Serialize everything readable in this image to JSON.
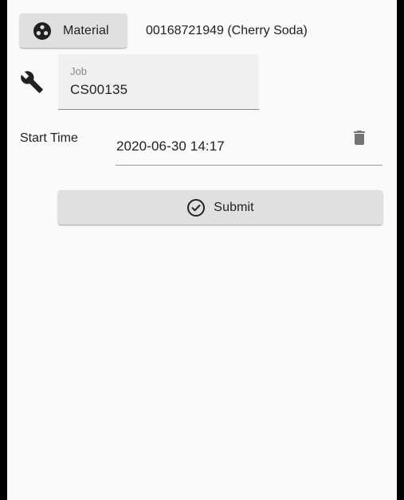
{
  "material": {
    "button_label": "Material",
    "button_icon": "material-icon",
    "value": "00168721949 (Cherry Soda)"
  },
  "job": {
    "icon": "wrench-icon",
    "label": "Job",
    "value": "CS00135"
  },
  "start_time": {
    "label": "Start Time",
    "value": "2020-06-30 14:17",
    "clear_icon": "trash-icon"
  },
  "submit": {
    "label": "Submit",
    "icon": "check-circle-icon"
  },
  "colors": {
    "background": "#fafafa",
    "button": "#e0e0e0",
    "field": "#f0f0f0",
    "text": "#212121",
    "muted": "#8a8a8a",
    "frame": "#000000"
  }
}
